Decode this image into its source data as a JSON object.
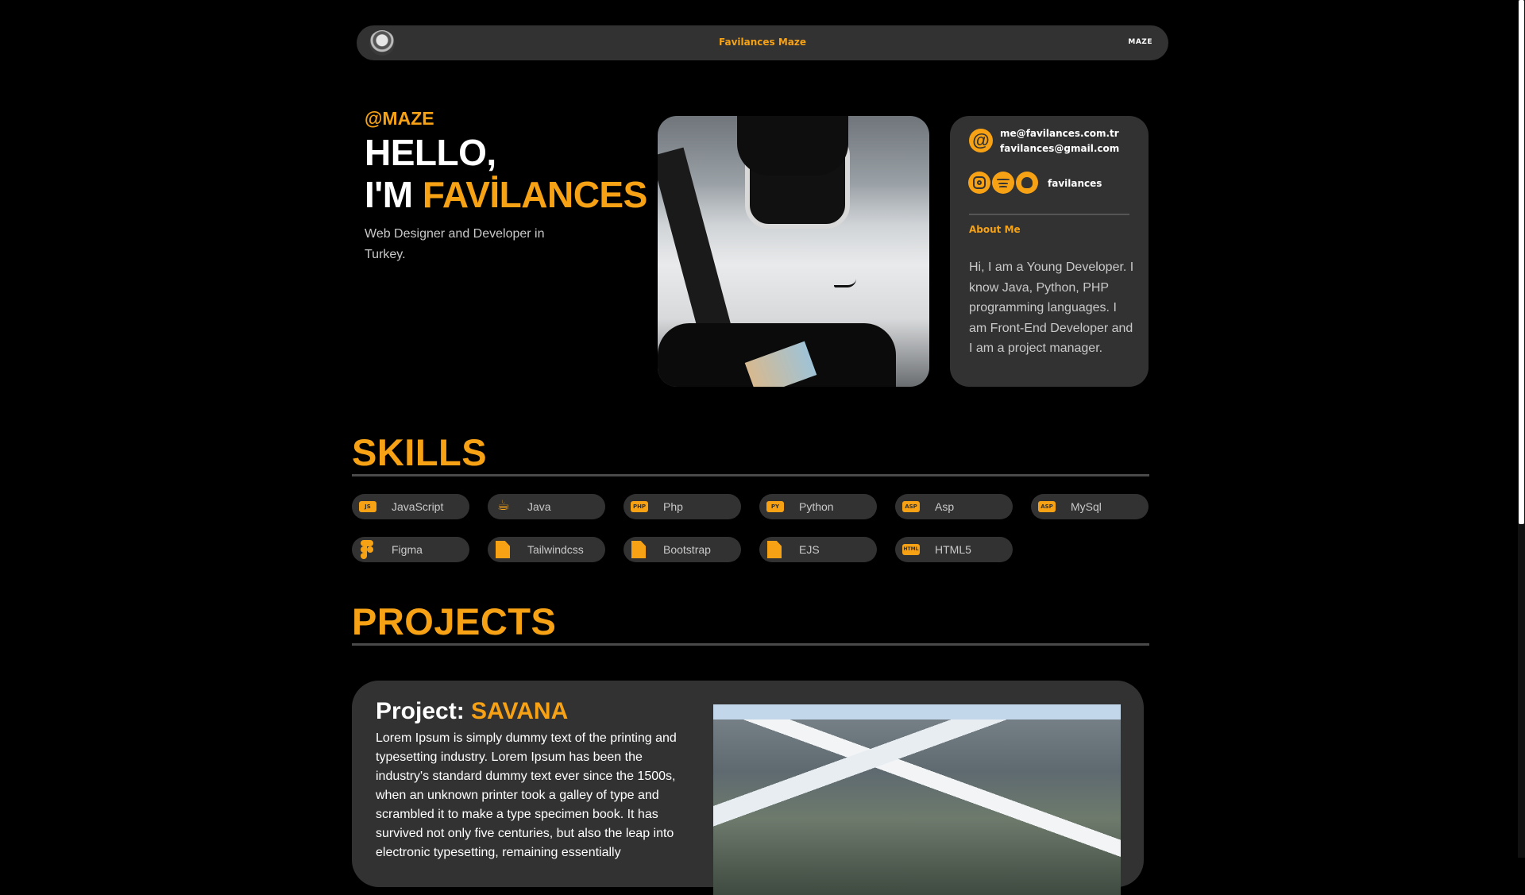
{
  "nav": {
    "title": "Favilances Maze",
    "brand": "MAZE"
  },
  "hero": {
    "handle": "@MAZE",
    "greeting_line1": "HELLO,",
    "greeting_prefix": "I'M ",
    "greeting_name": "FAVİLANCES",
    "subtitle": "Web Designer and Developer in Turkey."
  },
  "contact": {
    "at_symbol": "@",
    "email_primary": "me@favilances.com.tr",
    "email_secondary": "favilances@gmail.com",
    "social_icons": [
      "instagram-icon",
      "spotify-icon",
      "github-icon"
    ],
    "username": "favilances",
    "about_title": "About Me",
    "about_text": "Hi, I am a Young Developer. I know Java, Python, PHP programming languages. I am Front-End Developer and I am a project manager."
  },
  "skills": {
    "title": "SKILLS",
    "items": [
      {
        "label": "JavaScript",
        "icon": "js-icon",
        "badge": "JS"
      },
      {
        "label": "Java",
        "icon": "java-icon",
        "badge": ""
      },
      {
        "label": "Php",
        "icon": "php-icon",
        "badge": "PHP"
      },
      {
        "label": "Python",
        "icon": "python-icon",
        "badge": "PY"
      },
      {
        "label": "Asp",
        "icon": "asp-icon",
        "badge": "ASP"
      },
      {
        "label": "MySql",
        "icon": "mysql-icon",
        "badge": "ASP"
      },
      {
        "label": "Figma",
        "icon": "figma-icon",
        "badge": ""
      },
      {
        "label": "Tailwindcss",
        "icon": "file-icon",
        "badge": ""
      },
      {
        "label": "Bootstrap",
        "icon": "file-icon",
        "badge": ""
      },
      {
        "label": "EJS",
        "icon": "file-icon",
        "badge": ""
      },
      {
        "label": "HTML5",
        "icon": "html-icon",
        "badge": "HTML"
      }
    ]
  },
  "projects": {
    "title": "PROJECTS",
    "items": [
      {
        "title_prefix": "Project: ",
        "title_name": "SAVANA",
        "description": "Lorem Ipsum is simply dummy text of the printing and typesetting industry. Lorem Ipsum has been the industry's standard dummy text ever since the 1500s, when an unknown printer took a galley of type and scrambled it to make a type specimen book. It has survived not only five centuries, but also the leap into electronic typesetting, remaining essentially"
      }
    ]
  },
  "colors": {
    "accent": "#f7a215",
    "background": "#000000",
    "card": "#323232"
  }
}
